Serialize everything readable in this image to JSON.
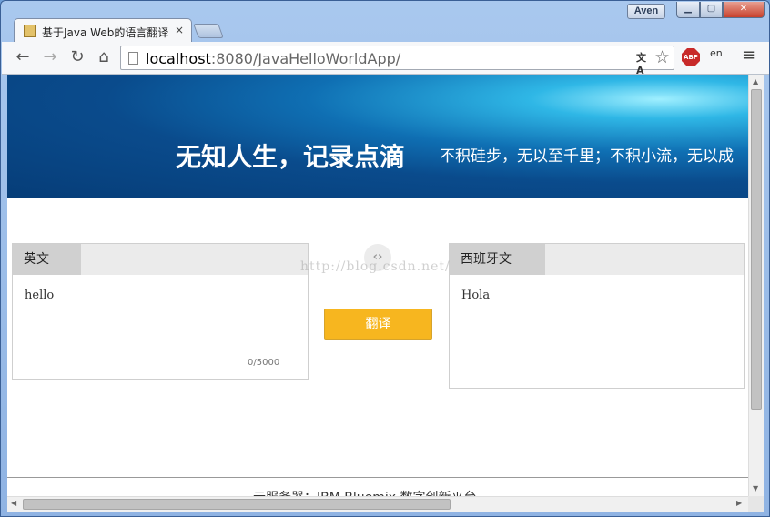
{
  "window": {
    "user_name": "Aven",
    "min_glyph": "▁",
    "max_glyph": "▢",
    "close_glyph": "✕"
  },
  "tab": {
    "title": "基于Java Web的语言翻译",
    "close_glyph": "×"
  },
  "toolbar": {
    "back_glyph": "←",
    "forward_glyph": "→",
    "reload_glyph": "↻",
    "home_glyph": "⌂",
    "url_host": "localhost",
    "url_rest": ":8080/JavaHelloWorldApp/",
    "translate_glyph": "文A",
    "star_glyph": "☆",
    "abp_label": "ABP",
    "ext_label": "en",
    "menu_glyph": "≡"
  },
  "banner": {
    "title": "无知人生，记录点滴",
    "subtitle": "不积硅步，无以至千里；不积小流，无以成"
  },
  "source_panel": {
    "language": "英文",
    "text": "hello",
    "counter": "0/5000"
  },
  "swap_glyph": "‹›",
  "translate_button": "翻译",
  "target_panel": {
    "language": "西班牙文",
    "text": "Hola"
  },
  "watermark": "http://blog.csdn.net/",
  "footer": {
    "text": "云服务器：IBM Bluemix 数字创新平台"
  },
  "scrollbar": {
    "up_glyph": "▲",
    "down_glyph": "▼",
    "left_glyph": "◀",
    "right_glyph": "▶"
  },
  "colors": {
    "accent_button": "#f7b61f",
    "banner_dark": "#063d78",
    "banner_light": "#2fb7e6"
  }
}
